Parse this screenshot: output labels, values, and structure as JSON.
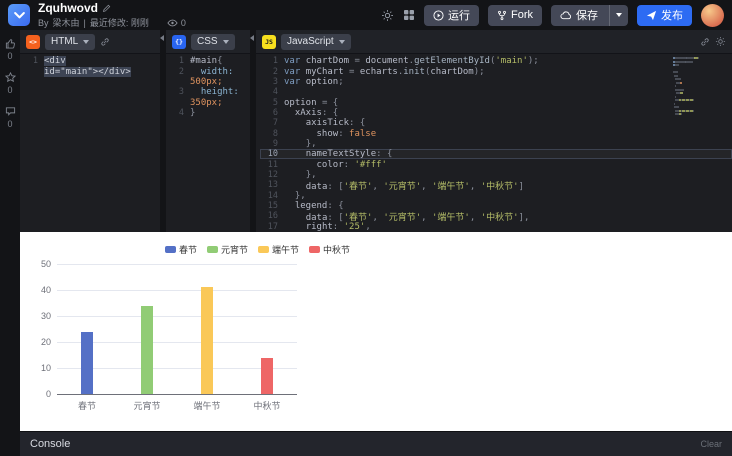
{
  "header": {
    "title": "Zquhwovd",
    "byline": {
      "by": "By",
      "author": "梁木由",
      "separator": "|",
      "modified": "最近修改: 刚刚"
    },
    "views_count": "0",
    "actions": {
      "run": "运行",
      "fork": "Fork",
      "save": "保存",
      "publish": "发布"
    }
  },
  "sidebar": {
    "items": [
      {
        "icon": "thumb-up-icon",
        "count": "0"
      },
      {
        "icon": "star-icon",
        "count": "0"
      },
      {
        "icon": "comment-icon",
        "count": "0"
      }
    ]
  },
  "panels": {
    "html": {
      "label": "HTML",
      "icon_text": "<>"
    },
    "css": {
      "label": "CSS",
      "icon_text": "{}"
    },
    "js": {
      "label": "JavaScript",
      "icon_text": "JS"
    }
  },
  "editors": {
    "html": {
      "lines": [
        {
          "num": "1",
          "tokens": [
            [
              "sel",
              "<div"
            ]
          ]
        },
        {
          "num": "",
          "tokens": [
            [
              "sel",
              "id=\"main\""
            ],
            [
              "sel",
              "></div>"
            ]
          ]
        }
      ]
    },
    "css": {
      "lines": [
        {
          "num": "1",
          "tokens": [
            [
              "def",
              "#main"
            ],
            [
              "pun",
              "{"
            ]
          ]
        },
        {
          "num": "2",
          "tokens": [
            [
              "ws",
              "  "
            ],
            [
              "cprop",
              "width:"
            ]
          ]
        },
        {
          "num": "",
          "tokens": [
            [
              "val",
              "500px;"
            ]
          ]
        },
        {
          "num": "3",
          "tokens": [
            [
              "ws",
              "  "
            ],
            [
              "cprop",
              "height:"
            ]
          ]
        },
        {
          "num": "",
          "tokens": [
            [
              "val",
              "350px;"
            ]
          ]
        },
        {
          "num": "4",
          "tokens": [
            [
              "pun",
              "}"
            ]
          ]
        }
      ]
    },
    "js": {
      "lines": [
        {
          "num": "1",
          "tokens": [
            [
              "kw",
              "var "
            ],
            [
              "def",
              "chartDom "
            ],
            [
              "pun",
              "= "
            ],
            [
              "def",
              "document"
            ],
            [
              "pun",
              "."
            ],
            [
              "fn",
              "getElementById"
            ],
            [
              "pun",
              "("
            ],
            [
              "str",
              "'main'"
            ],
            [
              "pun",
              ");"
            ]
          ]
        },
        {
          "num": "2",
          "tokens": [
            [
              "kw",
              "var "
            ],
            [
              "def",
              "myChart "
            ],
            [
              "pun",
              "= "
            ],
            [
              "def",
              "echarts"
            ],
            [
              "pun",
              "."
            ],
            [
              "fn",
              "init"
            ],
            [
              "pun",
              "("
            ],
            [
              "def",
              "chartDom"
            ],
            [
              "pun",
              ");"
            ]
          ]
        },
        {
          "num": "3",
          "tokens": [
            [
              "kw",
              "var "
            ],
            [
              "def",
              "option"
            ],
            [
              "pun",
              ";"
            ]
          ]
        },
        {
          "num": "4",
          "tokens": []
        },
        {
          "num": "5",
          "tokens": [
            [
              "def",
              "option "
            ],
            [
              "pun",
              "= {"
            ]
          ]
        },
        {
          "num": "6",
          "tokens": [
            [
              "ws",
              "  "
            ],
            [
              "prop",
              "xAxis"
            ],
            [
              "pun",
              ": {"
            ]
          ]
        },
        {
          "num": "7",
          "tokens": [
            [
              "ws",
              "    "
            ],
            [
              "prop",
              "axisTick"
            ],
            [
              "pun",
              ": {"
            ]
          ]
        },
        {
          "num": "8",
          "tokens": [
            [
              "ws",
              "      "
            ],
            [
              "prop",
              "show"
            ],
            [
              "pun",
              ": "
            ],
            [
              "lit",
              "false"
            ]
          ]
        },
        {
          "num": "9",
          "tokens": [
            [
              "ws",
              "    "
            ],
            [
              "pun",
              "},"
            ]
          ]
        },
        {
          "num": "10",
          "active": true,
          "tokens": [
            [
              "ws",
              "    "
            ],
            [
              "prop",
              "nameTextStyle"
            ],
            [
              "pun",
              ": {"
            ]
          ]
        },
        {
          "num": "11",
          "tokens": [
            [
              "ws",
              "      "
            ],
            [
              "prop",
              "color"
            ],
            [
              "pun",
              ": "
            ],
            [
              "str",
              "'#fff'"
            ]
          ]
        },
        {
          "num": "12",
          "tokens": [
            [
              "ws",
              "    "
            ],
            [
              "pun",
              "},"
            ]
          ]
        },
        {
          "num": "13",
          "tokens": [
            [
              "ws",
              "    "
            ],
            [
              "prop",
              "data"
            ],
            [
              "pun",
              ": ["
            ],
            [
              "str",
              "'春节'"
            ],
            [
              "pun",
              ", "
            ],
            [
              "str",
              "'元宵节'"
            ],
            [
              "pun",
              ", "
            ],
            [
              "str",
              "'端午节'"
            ],
            [
              "pun",
              ", "
            ],
            [
              "str",
              "'中秋节'"
            ],
            [
              "pun",
              "]"
            ]
          ]
        },
        {
          "num": "14",
          "tokens": [
            [
              "ws",
              "  "
            ],
            [
              "pun",
              "},"
            ]
          ]
        },
        {
          "num": "15",
          "tokens": [
            [
              "ws",
              "  "
            ],
            [
              "prop",
              "legend"
            ],
            [
              "pun",
              ": {"
            ]
          ]
        },
        {
          "num": "16",
          "tokens": [
            [
              "ws",
              "    "
            ],
            [
              "prop",
              "data"
            ],
            [
              "pun",
              ": ["
            ],
            [
              "str",
              "'春节'"
            ],
            [
              "pun",
              ", "
            ],
            [
              "str",
              "'元宵节'"
            ],
            [
              "pun",
              ", "
            ],
            [
              "str",
              "'端午节'"
            ],
            [
              "pun",
              ", "
            ],
            [
              "str",
              "'中秋节'"
            ],
            [
              "pun",
              "],"
            ]
          ]
        },
        {
          "num": "17",
          "tokens": [
            [
              "ws",
              "    "
            ],
            [
              "prop",
              "right"
            ],
            [
              "pun",
              ": "
            ],
            [
              "str",
              "'25'"
            ],
            [
              "pun",
              ","
            ]
          ]
        }
      ]
    }
  },
  "console": {
    "title": "Console",
    "clear": "Clear"
  },
  "chart_data": {
    "type": "bar",
    "title": "",
    "categories": [
      "春节",
      "元宵节",
      "端午节",
      "中秋节"
    ],
    "values": [
      24,
      34,
      41,
      14
    ],
    "colors": [
      "#5470c6",
      "#91cc75",
      "#fac858",
      "#ee6666"
    ],
    "legend": [
      "春节",
      "元宵节",
      "端午节",
      "中秋节"
    ],
    "legend_position": "top-right",
    "xlabel": "",
    "ylabel": "",
    "ylim": [
      0,
      50
    ],
    "ytick_step": 10,
    "grid": true
  },
  "colors": {
    "header_bg": "#131417",
    "panel_bg": "#1d1e22",
    "button_bg": "#444857",
    "publish_blue": "#2d6bf3",
    "html_orange": "#f4611e",
    "css_blue": "#2965f1",
    "js_yellow": "#f7df1e"
  }
}
